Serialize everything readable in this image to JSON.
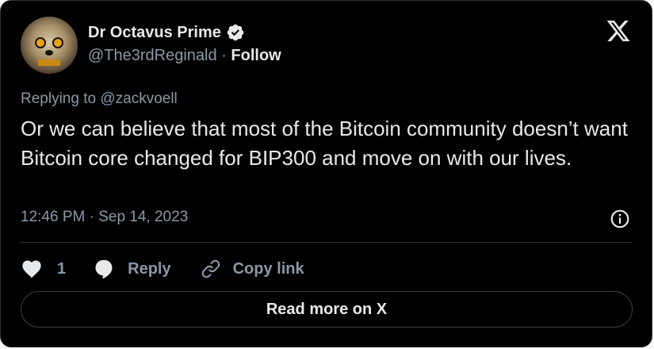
{
  "author": {
    "name": "Dr Octavus Prime",
    "handle": "@The3rdReginald",
    "separator": "·",
    "follow_label": "Follow",
    "verified": true
  },
  "tweet": {
    "replying_prefix": "Replying to",
    "replying_to": "@zackvoell",
    "text": "Or we can believe that most of the Bitcoin community doesn’t want Bitcoin core changed for BIP300 and move on with our lives.",
    "timestamp": "12:46 PM · Sep 14, 2023"
  },
  "actions": {
    "like_count": "1",
    "reply_label": "Reply",
    "copy_link_label": "Copy link"
  },
  "footer": {
    "read_more_label": "Read more on X"
  },
  "icons": {
    "logo": "x-logo-icon",
    "verified": "verified-badge-icon",
    "info": "info-icon",
    "like": "heart-icon",
    "reply": "speech-bubble-icon",
    "copy": "link-icon"
  },
  "colors": {
    "background": "#000000",
    "text": "#e7e9ea",
    "secondary_text": "#8b98a5",
    "border": "#2f3336"
  }
}
